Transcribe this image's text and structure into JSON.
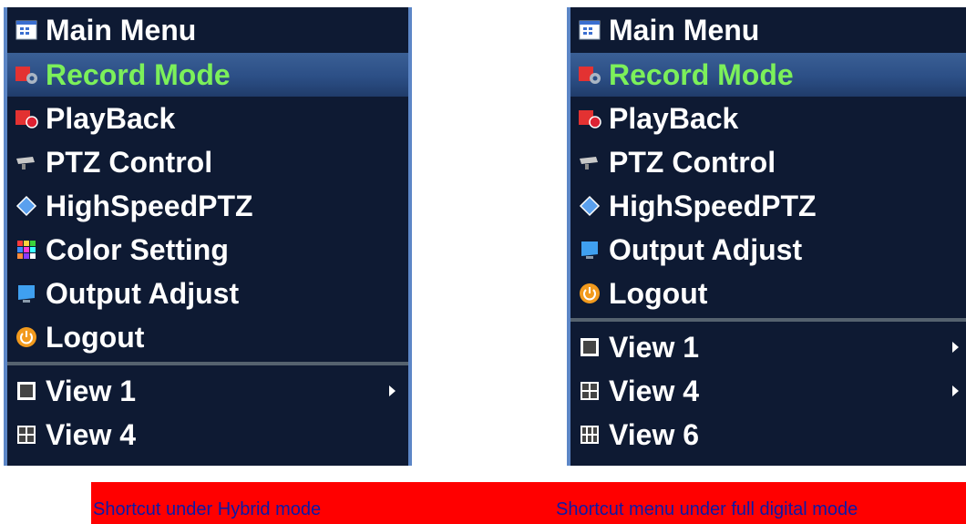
{
  "menus": [
    {
      "title": "Main Menu",
      "items": [
        {
          "label": "Record Mode",
          "icon": "record-mode-icon",
          "selected": true
        },
        {
          "label": "PlayBack",
          "icon": "playback-icon"
        },
        {
          "label": "PTZ Control",
          "icon": "ptz-control-icon"
        },
        {
          "label": "HighSpeedPTZ",
          "icon": "highspeed-ptz-icon"
        },
        {
          "label": "Color Setting",
          "icon": "color-setting-icon"
        },
        {
          "label": "Output Adjust",
          "icon": "output-adjust-icon"
        },
        {
          "label": "Logout",
          "icon": "logout-icon"
        }
      ],
      "views": [
        {
          "label": "View 1",
          "icon": "view1-icon",
          "submenu": true
        },
        {
          "label": "View 4",
          "icon": "view4-icon",
          "submenu": false
        }
      ]
    },
    {
      "title": "Main Menu",
      "items": [
        {
          "label": "Record Mode",
          "icon": "record-mode-icon",
          "selected": true
        },
        {
          "label": "PlayBack",
          "icon": "playback-icon"
        },
        {
          "label": "PTZ Control",
          "icon": "ptz-control-icon"
        },
        {
          "label": "HighSpeedPTZ",
          "icon": "highspeed-ptz-icon"
        },
        {
          "label": "Output Adjust",
          "icon": "output-adjust-icon"
        },
        {
          "label": "Logout",
          "icon": "logout-icon"
        }
      ],
      "views": [
        {
          "label": "View 1",
          "icon": "view1-icon",
          "submenu": true
        },
        {
          "label": "View 4",
          "icon": "view4-icon",
          "submenu": true
        },
        {
          "label": "View 6",
          "icon": "view6-icon",
          "submenu": false
        }
      ]
    }
  ],
  "captions": {
    "left": "Shortcut under Hybrid mode",
    "right": "Shortcut menu under full digital mode"
  },
  "colors": {
    "menu_bg": "#0e1a33",
    "menu_border": "#5c86c6",
    "selected_text": "#7cf05a",
    "caption_bar": "#ff0000",
    "caption_text": "#0a1aa8"
  }
}
